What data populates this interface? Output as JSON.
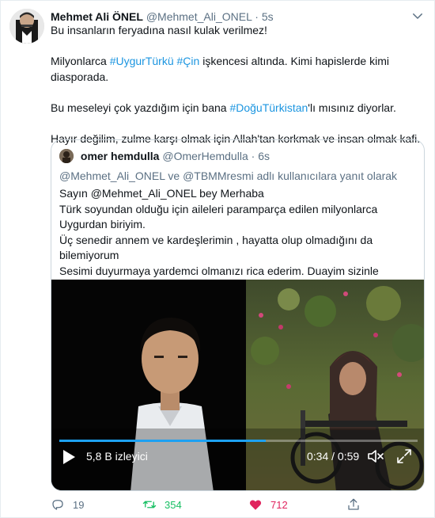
{
  "tweet": {
    "name": "Mehmet Ali ÖNEL",
    "handle": "@Mehmet_Ali_ONEL",
    "dot": "·",
    "time": "5s",
    "line1": "Bu insanların feryadına nasıl kulak verilmez!",
    "line2_pre": "Milyonlarca ",
    "line2_tag1": "#UygurTürkü",
    "line2_sp": " ",
    "line2_tag2": "#Çin",
    "line2_post": " işkencesi altında. Kimi hapislerde kimi",
    "line3": "diasporada.",
    "line4_pre": "Bu meseleyi çok yazdığım için bana ",
    "line4_tag": "#DoğuTürkistan",
    "line4_post": "'lı mısınız diyorlar.",
    "line5": "Hayır değilim,  zulme karşı olmak için Allah'tan korkmak ve insan olmak kafi."
  },
  "quoted": {
    "name": "omer hemdulla",
    "handle": "@OmerHemdulla",
    "dot": "·",
    "time": "6s",
    "reply_to": "@Mehmet_Ali_ONEL ve @TBMMresmi adlı kullanıcılara yanıt olarak",
    "lines": [
      "Sayın @Mehmet_Ali_ONEL bey Merhaba",
      "Türk soyundan olduğu için aileleri paramparça edilen milyonlarca",
      "Uygurdan biriyim.",
      "Üç senedir annem ve kardeşlerimin , hayatta olup olmadığını da",
      "bilemiyorum",
      "Sesimi duyurmaya yardemci olmanızı rica ederim. Duayim sizinle"
    ]
  },
  "video": {
    "views": "5,8 B izleyici",
    "time": "0:34 / 0:59",
    "progress": 0.576
  },
  "actions": {
    "reply_count": "19",
    "retweet_count": "354",
    "like_count": "712"
  },
  "icons": {
    "caret": "chevron-down-icon",
    "play": "play-icon",
    "volume": "volume-muted-icon",
    "fullscreen": "fullscreen-icon",
    "reply": "reply-icon",
    "retweet": "retweet-icon",
    "like": "heart-icon",
    "share": "share-icon"
  },
  "colors": {
    "link": "#1b95e0",
    "secondary": "#5b7083",
    "retweet": "#17bf63",
    "like": "#e0245e",
    "progress": "#1da1f2"
  }
}
